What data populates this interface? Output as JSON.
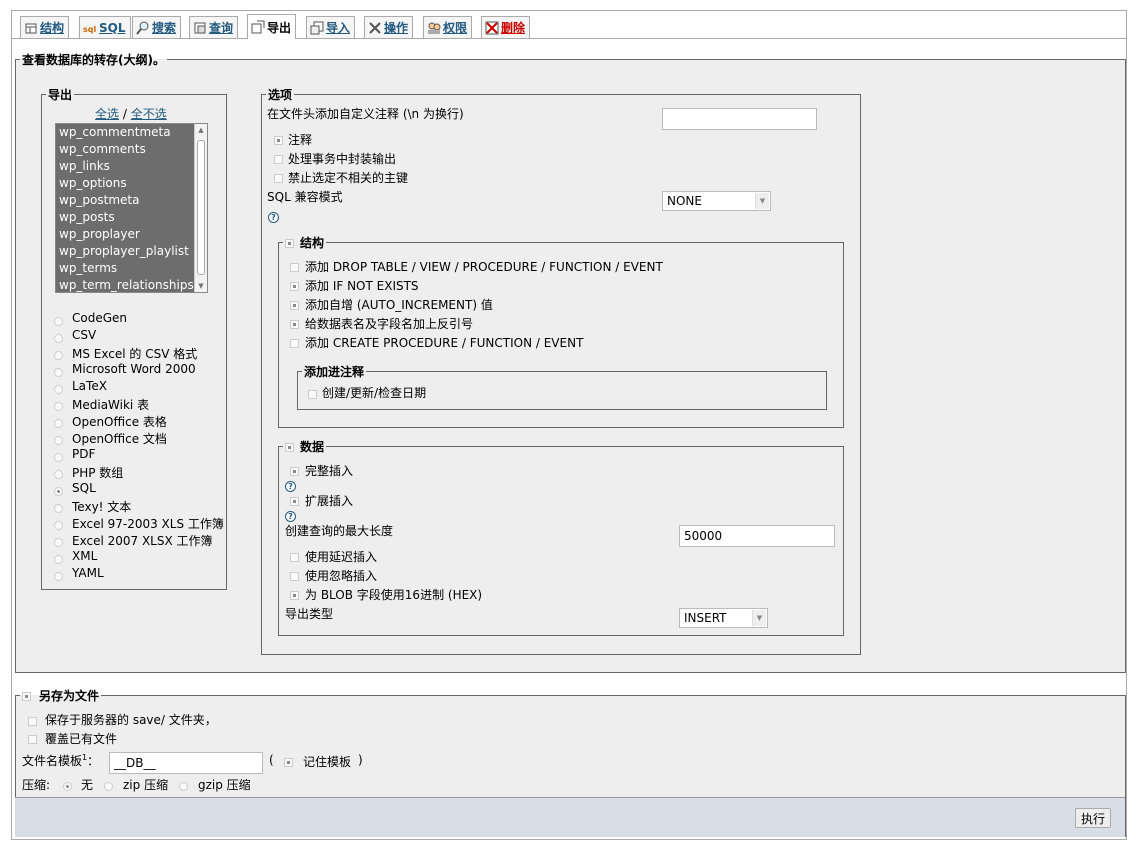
{
  "tabs": [
    {
      "label": "结构",
      "icon": "structure-icon"
    },
    {
      "label": "SQL",
      "icon": "sql-icon"
    },
    {
      "label": "搜索",
      "icon": "search-icon"
    },
    {
      "label": "查询",
      "icon": "query-icon"
    },
    {
      "label": "导出",
      "icon": "export-icon",
      "active": true
    },
    {
      "label": "导入",
      "icon": "import-icon"
    },
    {
      "label": "操作",
      "icon": "operations-icon"
    },
    {
      "label": "权限",
      "icon": "privileges-icon"
    },
    {
      "label": "删除",
      "icon": "drop-icon"
    }
  ],
  "main_legend": "查看数据库的转存(大纲)。",
  "export": {
    "legend": "导出",
    "select_all": "全选",
    "separator": "/",
    "deselect_all": "全不选",
    "tables": [
      "wp_commentmeta",
      "wp_comments",
      "wp_links",
      "wp_options",
      "wp_postmeta",
      "wp_posts",
      "wp_proplayer",
      "wp_proplayer_playlist",
      "wp_terms",
      "wp_term_relationships"
    ],
    "formats": [
      "CodeGen",
      "CSV",
      "MS Excel 的 CSV 格式",
      "Microsoft Word 2000",
      "LaTeX",
      "MediaWiki 表",
      "OpenOffice 表格",
      "OpenOffice 文档",
      "PDF",
      "PHP 数组",
      "SQL",
      "Texy! 文本",
      "Excel 97-2003 XLS 工作簿",
      "Excel 2007 XLSX 工作簿",
      "XML",
      "YAML"
    ],
    "selected_format": "SQL"
  },
  "options": {
    "legend": "选项",
    "header_comment_label": "在文件头添加自定义注释 (\\n 为换行)",
    "header_comment_value": "",
    "comments": "注释",
    "enclose_transaction": "处理事务中封装输出",
    "disable_fk": "禁止选定不相关的主键",
    "compat_label": "SQL 兼容模式",
    "compat_value": "NONE",
    "structure": {
      "legend": "结构",
      "drop": "添加 DROP TABLE / VIEW / PROCEDURE / FUNCTION / EVENT",
      "if_not_exists": "添加 IF NOT EXISTS",
      "auto_increment": "添加自增 (AUTO_INCREMENT) 值",
      "backquotes": "给数据表名及字段名加上反引号",
      "create_procedure": "添加 CREATE PROCEDURE / FUNCTION / EVENT",
      "comments_legend": "添加进注释",
      "dates": "创建/更新/检查日期"
    },
    "data": {
      "legend": "数据",
      "complete_inserts": "完整插入",
      "extended_inserts": "扩展插入",
      "max_query_label": "创建查询的最大长度",
      "max_query_value": "50000",
      "delayed": "使用延迟插入",
      "ignore": "使用忽略插入",
      "hex": "为 BLOB 字段使用16进制 (HEX)",
      "export_type_label": "导出类型",
      "export_type_value": "INSERT"
    }
  },
  "save": {
    "legend": "另存为文件",
    "save_on_server": "保存于服务器的 save/ 文件夹，",
    "overwrite": "覆盖已有文件",
    "template_label": "文件名模板",
    "template_sup": "1",
    "template_colon": "：",
    "template_value": "__DB__",
    "remember_open": "(",
    "remember": "记住模板",
    "remember_close": ")",
    "compression_label": "压缩:",
    "none": "无",
    "zip": "zip 压缩",
    "gzip": "gzip 压缩"
  },
  "go_button": "执行"
}
